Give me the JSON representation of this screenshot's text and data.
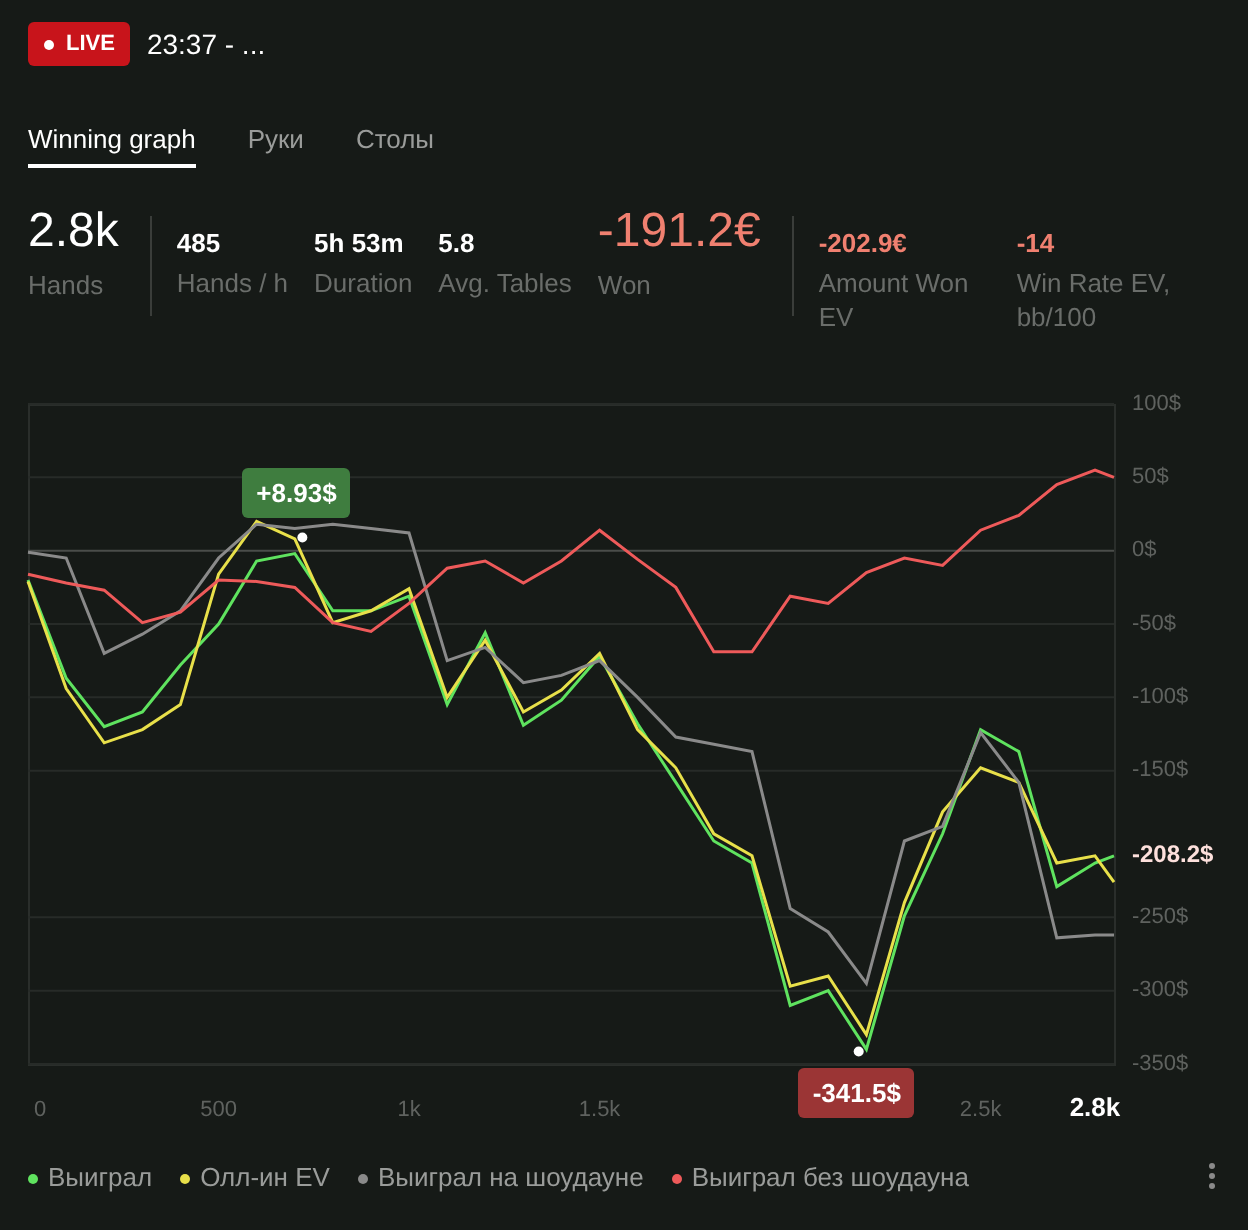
{
  "header": {
    "badge": "LIVE",
    "title": "23:37 - ..."
  },
  "tabs": [
    {
      "label": "Winning graph",
      "selected": true
    },
    {
      "label": "Руки",
      "selected": false
    },
    {
      "label": "Столы",
      "selected": false
    }
  ],
  "stat_groups": [
    [
      {
        "value": "2.8k",
        "label": "Hands",
        "kind": "big",
        "negative": false
      }
    ],
    [
      {
        "value": "485",
        "label": "Hands / h",
        "kind": "small",
        "negative": false
      },
      {
        "value": "5h 53m",
        "label": "Duration",
        "kind": "small",
        "negative": false
      },
      {
        "value": "5.8",
        "label": "Avg. Tables",
        "kind": "small",
        "negative": false
      },
      {
        "value": "-191.2€",
        "label": "Won",
        "kind": "big",
        "negative": true
      }
    ],
    [
      {
        "value": "-202.9€",
        "label": "Amount Won EV",
        "kind": "small",
        "negative": true
      },
      {
        "value": "-14",
        "label": "Win Rate EV, bb/100",
        "kind": "small",
        "negative": true
      }
    ]
  ],
  "chart": {
    "chart_data": {
      "type": "line",
      "x": [
        0,
        100,
        200,
        300,
        400,
        500,
        600,
        700,
        800,
        900,
        1000,
        1100,
        1200,
        1300,
        1400,
        1500,
        1600,
        1700,
        1800,
        1900,
        2000,
        2100,
        2200,
        2300,
        2400,
        2500,
        2600,
        2700,
        2800,
        2850
      ],
      "series": [
        {
          "name": "Выиграл",
          "color": "#5fe35f",
          "values": [
            -20,
            -87,
            -120,
            -110,
            -78,
            -50,
            -7,
            -2,
            -41,
            -41,
            -31,
            -105,
            -56,
            -119,
            -102,
            -72,
            -118,
            -158,
            -198,
            -213,
            -310,
            -300,
            -340,
            -249,
            -193,
            -122,
            -137,
            -229,
            -213,
            -208
          ]
        },
        {
          "name": "Олл-ин EV",
          "color": "#e8e04a",
          "values": [
            -21,
            -94,
            -131,
            -122,
            -105,
            -16,
            20,
            8,
            -49,
            -41,
            -26,
            -100,
            -61,
            -110,
            -95,
            -70,
            -122,
            -148,
            -193,
            -208,
            -297,
            -290,
            -330,
            -240,
            -178,
            -148,
            -158,
            -213,
            -208,
            -226
          ]
        },
        {
          "name": "Выиграл на шоудауне",
          "color": "#8a8a8a",
          "values": [
            -1,
            -5,
            -70,
            -57,
            -41,
            -5,
            18,
            15,
            18,
            15,
            12,
            -75,
            -66,
            -90,
            -85,
            -75,
            -100,
            -127,
            -132,
            -137,
            -244,
            -260,
            -295,
            -198,
            -188,
            -124,
            -158,
            -264,
            -262,
            -262
          ]
        },
        {
          "name": "Выиграл без шоудауна",
          "color": "#ee5a5a",
          "values": [
            -16,
            -22,
            -27,
            -49,
            -42,
            -20,
            -21,
            -25,
            -49,
            -55,
            -36,
            -12,
            -7,
            -22,
            -7,
            14,
            -6,
            -25,
            -69,
            -69,
            -31,
            -36,
            -15,
            -5,
            -10,
            14,
            24,
            45,
            55,
            50
          ]
        }
      ],
      "xlim": [
        0,
        2850
      ],
      "ylim": [
        -350,
        100
      ],
      "grid": true,
      "xticks": [
        {
          "value": 0,
          "label": "0"
        },
        {
          "value": 500,
          "label": "500"
        },
        {
          "value": 1000,
          "label": "1k"
        },
        {
          "value": 1500,
          "label": "1.5k"
        },
        {
          "value": 2500,
          "label": "2.5k"
        },
        {
          "value": 2800,
          "label": "2.8k"
        }
      ],
      "yticks": [
        {
          "value": 100,
          "label": "100$"
        },
        {
          "value": 50,
          "label": "50$"
        },
        {
          "value": 0,
          "label": "0$"
        },
        {
          "value": -50,
          "label": "-50$"
        },
        {
          "value": -100,
          "label": "-100$"
        },
        {
          "value": -150,
          "label": "-150$"
        },
        {
          "value": -250,
          "label": "-250$"
        },
        {
          "value": -300,
          "label": "-300$"
        },
        {
          "value": -350,
          "label": "-350$"
        }
      ],
      "annotations": [
        {
          "x": 720,
          "y": 8.93,
          "text": "+8.93$"
        },
        {
          "x": 2180,
          "y": -341.5,
          "text": "-341.5$"
        },
        {
          "x": 2850,
          "y": -208.2,
          "text": "-208.2$"
        }
      ]
    }
  }
}
